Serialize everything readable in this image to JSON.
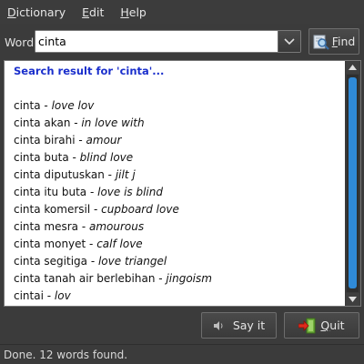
{
  "menu": {
    "items": [
      {
        "accel": "D",
        "rest": "ictionary"
      },
      {
        "accel": "E",
        "rest": "dit"
      },
      {
        "accel": "H",
        "rest": "elp"
      }
    ]
  },
  "search": {
    "label": "Word",
    "value": "cinta",
    "find_accel": "F",
    "find_rest": "ind"
  },
  "results": {
    "header": "Search result for 'cinta'...",
    "items": [
      {
        "word": "cinta - ",
        "translation": "love lov"
      },
      {
        "word": "cinta akan - ",
        "translation": "in love with"
      },
      {
        "word": "cinta birahi - ",
        "translation": "amour"
      },
      {
        "word": "cinta buta - ",
        "translation": "blind love"
      },
      {
        "word": "cinta diputuskan - ",
        "translation": "jilt j"
      },
      {
        "word": "cinta itu buta - ",
        "translation": "love is blind"
      },
      {
        "word": "cinta komersil - ",
        "translation": "cupboard love"
      },
      {
        "word": "cinta mesra - ",
        "translation": "amourous"
      },
      {
        "word": "cinta monyet - ",
        "translation": "calf love"
      },
      {
        "word": "cinta segitiga - ",
        "translation": "love triangel"
      },
      {
        "word": "cinta tanah air berlebihan - ",
        "translation": "jingoism"
      },
      {
        "word": "cintai - ",
        "translation": "lov"
      }
    ]
  },
  "buttons": {
    "say_label": "Say it",
    "quit_accel": "Q",
    "quit_rest": "uit"
  },
  "status": {
    "text": "Done. 12 words found."
  },
  "colors": {
    "header_blue": "#1a2fcc",
    "scroll_thumb": "#2f8ad8",
    "window_bg": "#3b3b3b"
  },
  "icons": [
    "chevron-down-icon",
    "magnifier-icon",
    "speaker-icon",
    "exit-door-icon",
    "scroll-up-arrow-icon",
    "scroll-down-arrow-icon"
  ]
}
